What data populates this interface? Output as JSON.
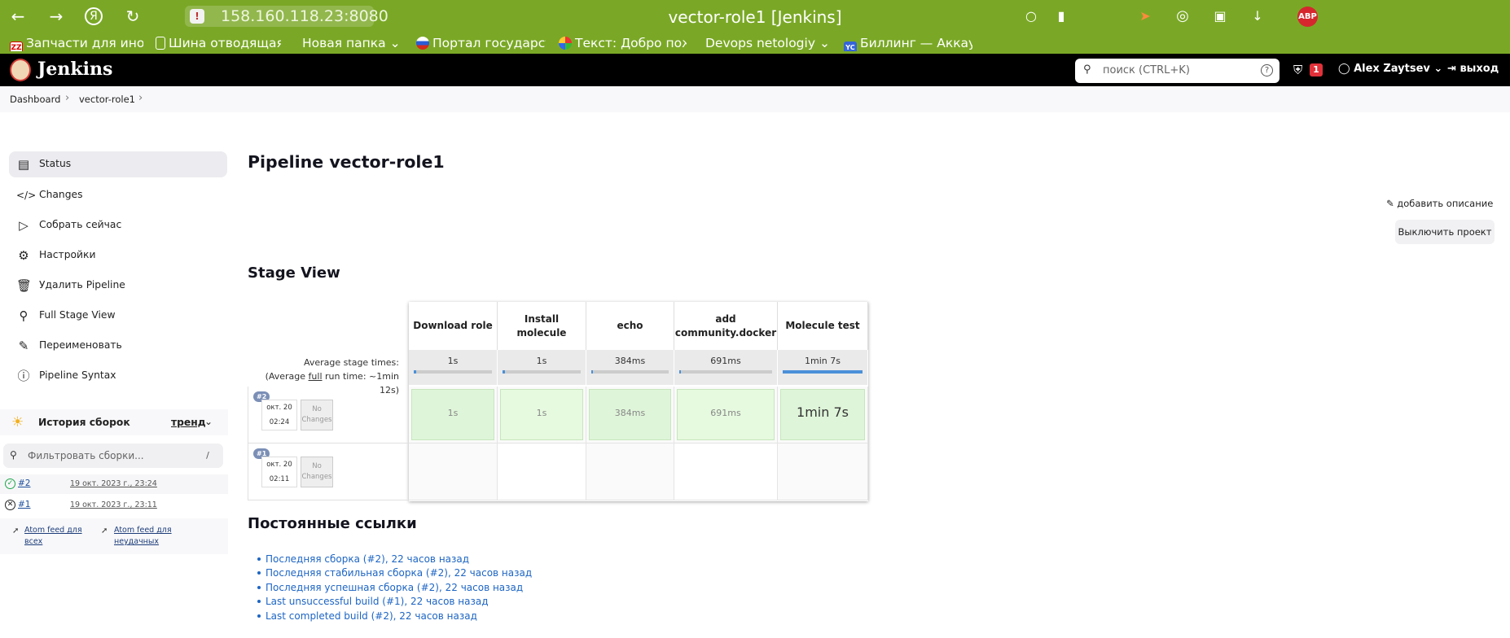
{
  "browser": {
    "url": "158.160.118.23:8080",
    "window_title": "vector-role1 [Jenkins]",
    "abp_label": "ABP",
    "bookmarks": [
      {
        "label": "Запчасти для ино",
        "icon": "zz-icon"
      },
      {
        "label": "Шина отводящая",
        "icon": "doc-icon"
      },
      {
        "label": "Новая папка",
        "icon": "folder-chevron"
      },
      {
        "label": "Портал государст",
        "icon": "gosuslugi-icon"
      },
      {
        "label": "Текст: Добро пож",
        "icon": "color-dots-icon"
      },
      {
        "label": "Devops netologiy",
        "icon": "folder-chevron"
      },
      {
        "label": "Биллинг — Аккау",
        "icon": "yc-icon"
      }
    ]
  },
  "jenkins": {
    "brand": "Jenkins",
    "search_placeholder": "поиск (CTRL+K)",
    "security_count": "1",
    "user": "Alex Zaytsev",
    "logout": "выход"
  },
  "breadcrumb": [
    "Dashboard",
    "vector-role1"
  ],
  "sidebar": {
    "items": [
      {
        "label": "Status",
        "icon": "document-icon"
      },
      {
        "label": "Changes",
        "icon": "code-icon"
      },
      {
        "label": "Собрать сейчас",
        "icon": "play-icon"
      },
      {
        "label": "Настройки",
        "icon": "gear-icon"
      },
      {
        "label": "Удалить Pipeline",
        "icon": "trash-icon"
      },
      {
        "label": "Full Stage View",
        "icon": "search-icon"
      },
      {
        "label": "Переименовать",
        "icon": "pencil-icon"
      },
      {
        "label": "Pipeline Syntax",
        "icon": "help-icon"
      }
    ],
    "history_title": "История сборок",
    "trend": "тренд",
    "filter_placeholder": "Фильтровать сборки...",
    "filter_key": "/",
    "builds": [
      {
        "num": "#2",
        "date": "19 окт. 2023 г., 23:24",
        "status": "success"
      },
      {
        "num": "#1",
        "date": "19 окт. 2023 г., 23:11",
        "status": "aborted"
      }
    ],
    "feed_all": "Atom feed для всех",
    "feed_failed": "Atom feed для неудачных"
  },
  "main": {
    "title": "Pipeline vector-role1",
    "add_description": "добавить описание",
    "disable_project": "Выключить проект",
    "stage_view_title": "Stage View",
    "avg_label_1": "Average stage times:",
    "avg_label_2_prefix": "(Average ",
    "avg_label_2_link": "full",
    "avg_label_2_suffix": " run time: ~1min 12s)",
    "stages": [
      {
        "name": "Download role",
        "avg": "1s",
        "fill": 0.03
      },
      {
        "name": "Install molecule",
        "avg": "1s",
        "fill": 0.03
      },
      {
        "name": "echo",
        "avg": "384ms",
        "fill": 0.02
      },
      {
        "name": "add community.docker",
        "avg": "691ms",
        "fill": 0.02
      },
      {
        "name": "Molecule test",
        "avg": "1min 7s",
        "fill": 1.0
      }
    ],
    "runs": [
      {
        "badge": "#2",
        "date": "окт. 20",
        "time": "02:24",
        "changes": "No Changes",
        "cells": [
          "1s",
          "1s",
          "384ms",
          "691ms",
          "1min 7s"
        ]
      },
      {
        "badge": "#1",
        "date": "окт. 20",
        "time": "02:11",
        "changes": "No Changes",
        "cells": [
          "",
          "",
          "",
          "",
          ""
        ]
      }
    ],
    "permalinks_title": "Постоянные ссылки",
    "permalinks": [
      "Последняя сборка (#2), 22 часов назад",
      "Последняя стабильная сборка (#2), 22 часов назад",
      "Последняя успешная сборка (#2), 22 часов назад",
      "Last unsuccessful build (#1), 22 часов назад",
      "Last completed build (#2), 22 часов назад"
    ]
  },
  "colors": {
    "browser_bar": "#7aa826",
    "header": "#000000",
    "stage_success": "#dff5d9",
    "link": "#1d65c4"
  }
}
